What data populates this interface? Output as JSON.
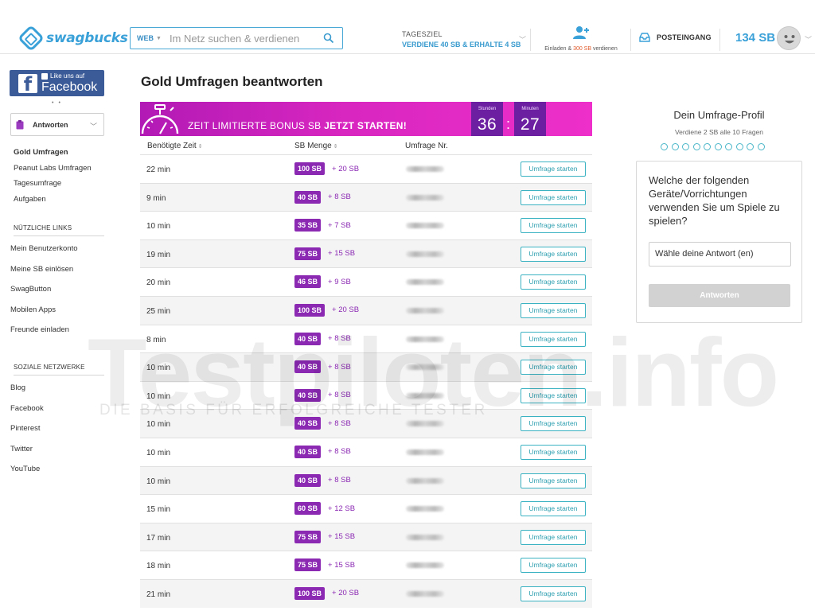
{
  "header": {
    "logo_text": "swagbucks",
    "search": {
      "scope": "WEB",
      "placeholder": "Im Netz suchen & verdienen"
    },
    "goal": {
      "title": "TAGESZIEL",
      "text": "VERDIENE 40 SB & ERHALTE 4 SB"
    },
    "invite": {
      "prefix": "Einladen & ",
      "highlight": "300 SB",
      "suffix": " verdienen"
    },
    "inbox_label": "POSTEINGANG",
    "balance": "134 SB"
  },
  "sidebar": {
    "facebook": {
      "small": "Like uns auf",
      "big": "Facebook"
    },
    "dropdown_label": "Antworten",
    "nav": [
      {
        "label": "Gold Umfragen",
        "active": true
      },
      {
        "label": "Peanut Labs Umfragen"
      },
      {
        "label": "Tagesumfrage"
      },
      {
        "label": "Aufgaben"
      }
    ],
    "useful_links_title": "NÜTZLICHE LINKS",
    "useful_links": [
      "Mein Benutzerkonto",
      "Meine SB einlösen",
      "SwagButton",
      "Mobilen Apps",
      "Freunde einladen"
    ],
    "social_title": "SOZIALE NETZWERKE",
    "social_links": [
      "Blog",
      "Facebook",
      "Pinterest",
      "Twitter",
      "YouTube"
    ]
  },
  "main": {
    "title": "Gold Umfragen beantworten",
    "promo": {
      "text_regular": "ZEIT LIMITIERTE BONUS SB ",
      "text_bold": "JETZT STARTEN!"
    },
    "timer": {
      "hours_label": "Stunden",
      "hours": "36",
      "minutes_label": "Minuten",
      "minutes": "27",
      "separator": ":"
    },
    "columns": {
      "time": "Benötigte Zeit",
      "sb": "SB Menge",
      "nr": "Umfrage Nr."
    },
    "start_label": "Umfrage starten",
    "surveys": [
      {
        "time": "22 min",
        "sb": "100 SB",
        "bonus": "+ 20 SB"
      },
      {
        "time": "9 min",
        "sb": "40 SB",
        "bonus": "+ 8 SB"
      },
      {
        "time": "10 min",
        "sb": "35 SB",
        "bonus": "+ 7 SB"
      },
      {
        "time": "19 min",
        "sb": "75 SB",
        "bonus": "+ 15 SB"
      },
      {
        "time": "20 min",
        "sb": "46 SB",
        "bonus": "+ 9 SB"
      },
      {
        "time": "25 min",
        "sb": "100 SB",
        "bonus": "+ 20 SB"
      },
      {
        "time": "8 min",
        "sb": "40 SB",
        "bonus": "+ 8 SB"
      },
      {
        "time": "10 min",
        "sb": "40 SB",
        "bonus": "+ 8 SB"
      },
      {
        "time": "10 min",
        "sb": "40 SB",
        "bonus": "+ 8 SB"
      },
      {
        "time": "10 min",
        "sb": "40 SB",
        "bonus": "+ 8 SB"
      },
      {
        "time": "10 min",
        "sb": "40 SB",
        "bonus": "+ 8 SB"
      },
      {
        "time": "10 min",
        "sb": "40 SB",
        "bonus": "+ 8 SB"
      },
      {
        "time": "15 min",
        "sb": "60 SB",
        "bonus": "+ 12 SB"
      },
      {
        "time": "17 min",
        "sb": "75 SB",
        "bonus": "+ 15 SB"
      },
      {
        "time": "18 min",
        "sb": "75 SB",
        "bonus": "+ 15 SB"
      },
      {
        "time": "21 min",
        "sb": "100 SB",
        "bonus": "+ 20 SB"
      }
    ]
  },
  "profile": {
    "title": "Dein Umfrage-Profil",
    "subtitle": "Verdiene 2 SB alle 10 Fragen",
    "question": "Welche der folgenden Geräte/Vorrichtungen verwenden Sie um Spiele zu spielen?",
    "select_placeholder": "Wähle deine Antwort (en)",
    "submit_label": "Antworten"
  },
  "watermark": {
    "main": "Testpiloten.info",
    "sub": "DIE BASIS FÜR ERFOLGREICHE TESTER"
  },
  "colors": {
    "brand": "#3aa0d8",
    "purple": "#8b29b3",
    "promo_pink": "#e02cc4",
    "teal": "#3ab2c1"
  }
}
